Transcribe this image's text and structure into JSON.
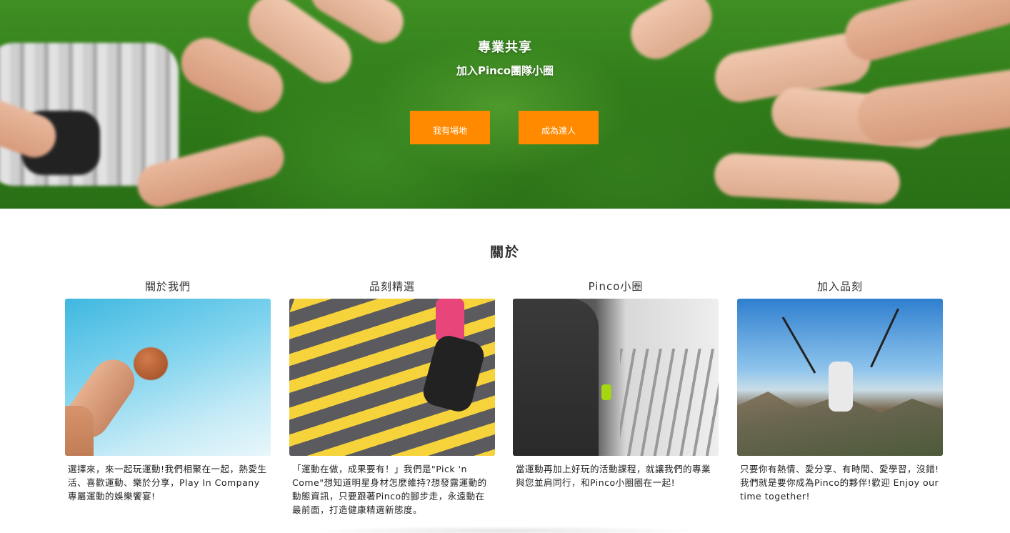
{
  "hero": {
    "title": "專業共享",
    "subtitle": "加入Pinco團隊小圈",
    "buttons": [
      {
        "label": "我有場地"
      },
      {
        "label": "成為達人"
      }
    ],
    "accent_color": "#ff8a00"
  },
  "about": {
    "title": "關於",
    "cards": [
      {
        "title": "關於我們",
        "text": "選擇來，來一起玩運動!我們相聚在一起，熱愛生活、喜歡運動、樂於分享，Play In Company 專屬運動的娛樂饗宴!"
      },
      {
        "title": "品刻精選",
        "text": "「運動在做，成果要有！」我們是\"Pick 'n Come\"想知道明星身材怎麼維持?想發露運動的動態資訊，只要跟著Pinco的腳步走，永遠動在最前面，打造健康精選新態度。"
      },
      {
        "title": "Pinco小圈",
        "text": "當運動再加上好玩的活動課程，就讓我們的專業與您並肩同行，和Pinco小圈圈在一起!"
      },
      {
        "title": "加入品刻",
        "text": "只要你有熱情、愛分享、有時間、愛學習，沒錯!我們就是要你成為Pinco的夥伴!歡迎 Enjoy our time together!"
      }
    ]
  }
}
